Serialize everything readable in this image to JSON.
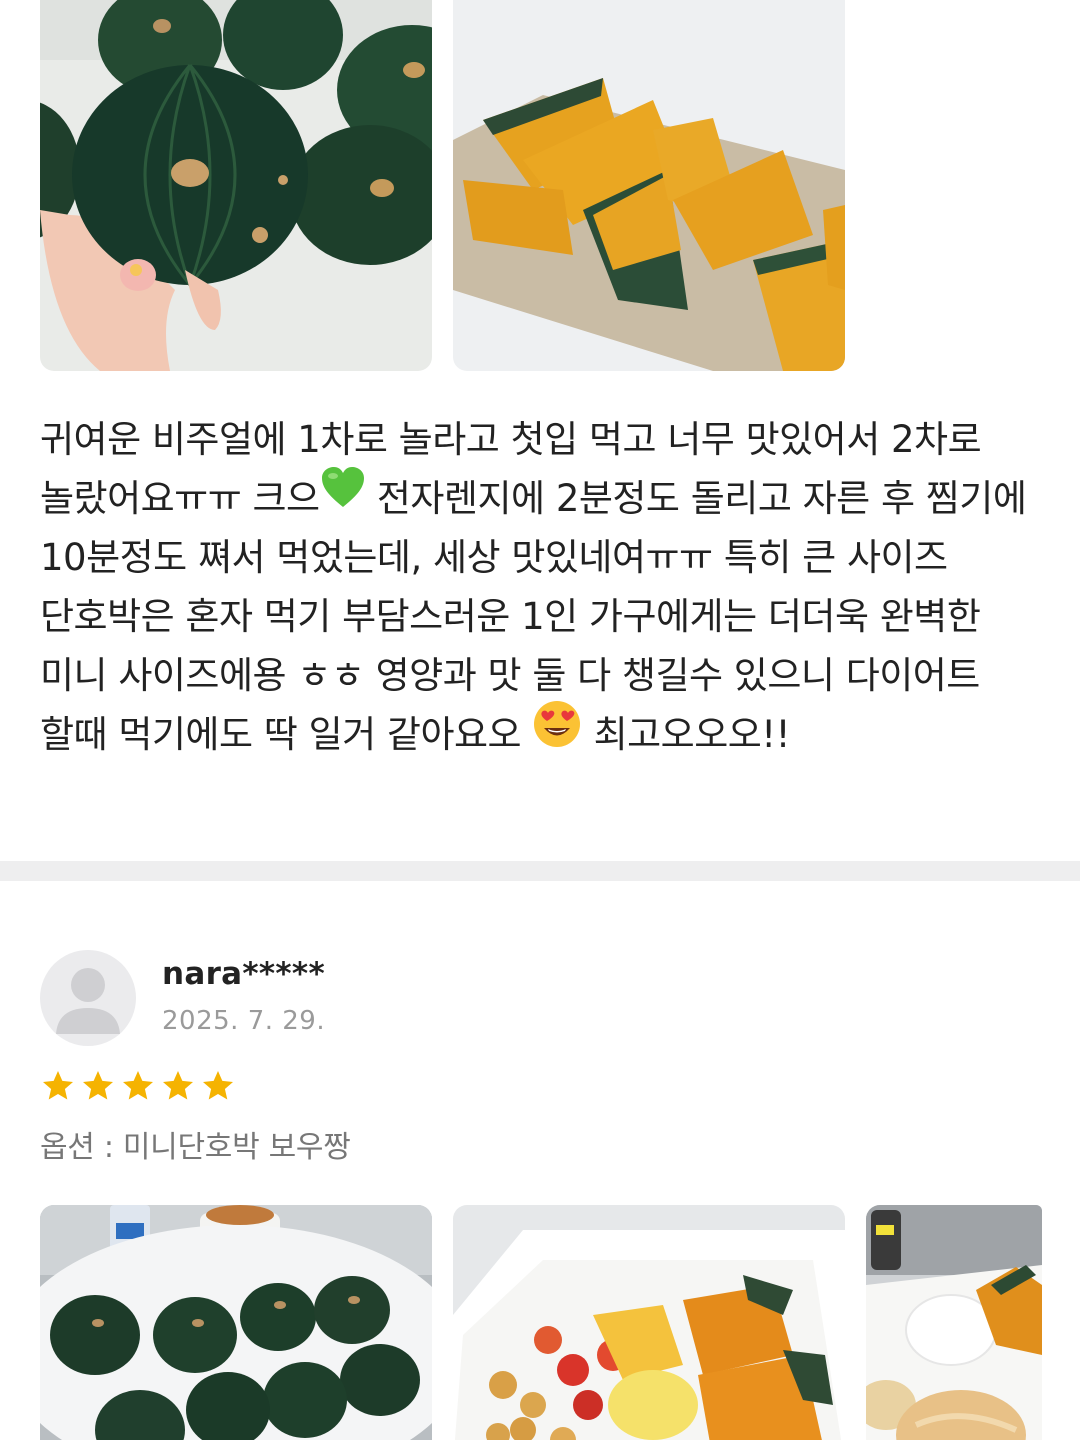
{
  "review_top": {
    "photos": [
      {
        "icon": "whole-mini-pumpkins-photo"
      },
      {
        "icon": "cooked-pumpkin-slices-photo"
      }
    ],
    "text": "귀여운 비주얼에 1차로 놀라고 첫입 먹고 너무 맛있어서 2차로 놀랐어요ㅠㅠ 크으",
    "emoji_1": "green-heart-icon",
    "text_2": " 전자렌지에 2분정도 돌리고 자른 후 찜기에 10분정도 쪄서 먹었는데, 세상 맛있네여ㅠㅠ 특히 큰 사이즈 단호박은 혼자 먹기 부담스러운 1인 가구에게는 더더욱 완벽한 미니 사이즈에용 ㅎㅎ 영양과 맛 둘 다 챙길수 있으니 다이어트 할때 먹기에도 딱 일거 같아요오 ",
    "emoji_2": "heart-eyes-icon",
    "text_3": " 최고오오오!!"
  },
  "review_next": {
    "username": "nara*****",
    "date": "2025. 7. 29.",
    "rating": 5,
    "star_color": "#f5b301",
    "option": "옵션 : 미니단호박 보우짱",
    "photos": [
      {
        "icon": "pumpkins-on-table-photo"
      },
      {
        "icon": "pumpkin-salad-bowl-photo"
      },
      {
        "icon": "pumpkin-plate-photo"
      }
    ]
  }
}
